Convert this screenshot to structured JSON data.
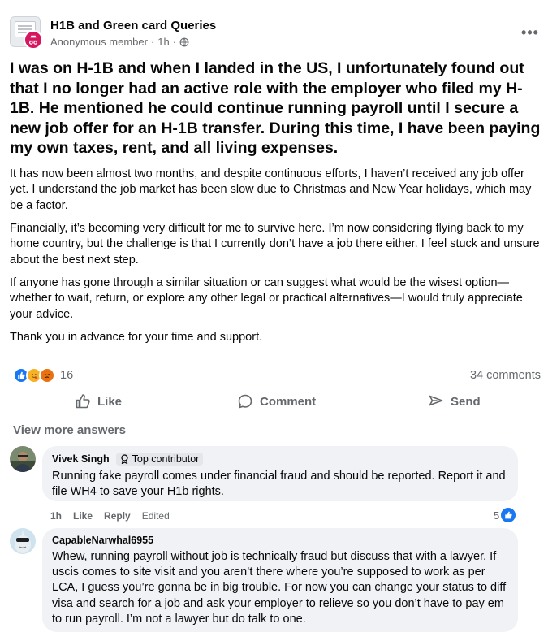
{
  "post": {
    "group_name": "H1B and Green card Queries",
    "author": "Anonymous member",
    "time": "1h",
    "meta_separator": "·",
    "more_icon": "more-horizontal-icon",
    "headline": "I was on H-1B and when I landed in the US, I unfortunately found out that I no longer had an active role with the employer who filed my H-1B. He mentioned he could continue running payroll until I secure a new job offer for an H-1B transfer. During this time, I have been paying my own taxes, rent, and all living expenses.",
    "paragraphs": [
      "It has now been almost two months, and despite continuous efforts, I haven’t received any job offer yet. I understand the job market has been slow due to Christmas and New Year holidays, which may be a factor.",
      "Financially, it’s becoming very difficult for me to survive here. I’m now considering flying back to my home country, but the challenge is that I currently don’t have a job there either. I feel stuck and unsure about the best next step.",
      "If anyone has gone through a similar situation or can suggest what would be the wisest option—whether to wait, return, or explore any other legal or practical alternatives—I would truly appreciate your advice.",
      "Thank you in advance for your time and support."
    ],
    "reaction_count": "16",
    "comments_count": "34 comments"
  },
  "actions": {
    "like": "Like",
    "comment": "Comment",
    "send": "Send"
  },
  "view_more": "View more answers",
  "comments": [
    {
      "name": "Vivek Singh",
      "badge": "Top contributor",
      "text": "Running fake payroll comes under financial fraud and should be reported. Report it and file WH4 to save your H1b rights.",
      "time": "1h",
      "like": "Like",
      "reply": "Reply",
      "edited": "Edited",
      "reactions": "5"
    },
    {
      "name": "CapableNarwhal6955",
      "text": "Whew, running payroll without job is technically fraud but discuss that with a lawyer. If uscis comes to site visit and you aren’t there where you’re supposed to work as per LCA, I guess you’re gonna be in big trouble. For now you can change your status to diff visa and search for a job and ask your employer to relieve so you don’t have to pay em to run payroll. I’m not a lawyer but do talk to one."
    }
  ],
  "colors": {
    "text": "#080809",
    "secondary": "#65686c",
    "bubble": "#f0f2f5",
    "like_blue": "#1877f2",
    "anon_pink": "#d6175f"
  }
}
